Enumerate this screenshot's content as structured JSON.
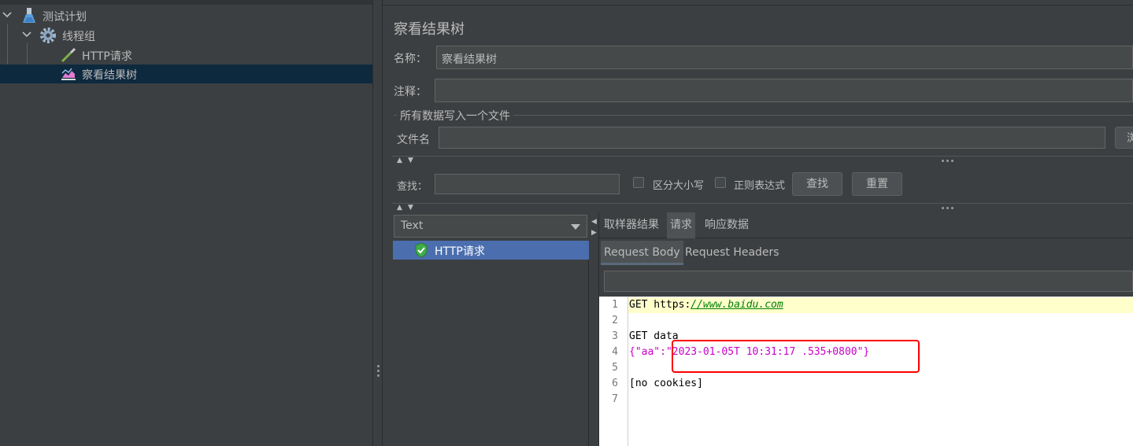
{
  "tree": {
    "items": [
      {
        "label": "测试计划",
        "icon": "flask-icon",
        "expanded": true
      },
      {
        "label": "线程组",
        "icon": "gear-icon",
        "expanded": true
      },
      {
        "label": "HTTP请求",
        "icon": "pipette-icon"
      },
      {
        "label": "察看结果树",
        "icon": "chart-icon",
        "selected": true
      }
    ]
  },
  "panel": {
    "title": "察看结果树",
    "name_label": "名称：",
    "name_value": "察看结果树",
    "comment_label": "注释：",
    "comment_value": "",
    "file_section_title": "所有数据写入一个文件",
    "file_label": "文件名",
    "file_value": "",
    "browse_button": "浏",
    "search_label": "查找：",
    "search_value": "",
    "case_sensitive_label": "区分大小写",
    "regex_label": "正则表达式",
    "find_button": "查找",
    "reset_button": "重置"
  },
  "results": {
    "renderer_selected": "Text",
    "samples": [
      {
        "label": "HTTP请求",
        "status": "success"
      }
    ]
  },
  "detail": {
    "tabs": [
      "取样器结果",
      "请求",
      "响应数据"
    ],
    "active_tab": "请求",
    "subtabs": [
      "Request Body",
      "Request Headers"
    ],
    "active_subtab": "Request Body",
    "lines": [
      {
        "n": "1",
        "text": "GET https://www.baidu.com"
      },
      {
        "n": "2",
        "text": ""
      },
      {
        "n": "3",
        "text": "GET data:"
      },
      {
        "n": "4",
        "text": "{\"aa\":\"2023-01-05T 10:31:17 .535+0800\"}"
      },
      {
        "n": "5",
        "text": ""
      },
      {
        "n": "6",
        "text": "[no cookies]"
      },
      {
        "n": "7",
        "text": ""
      }
    ],
    "line1_prefix": "GET https:",
    "line1_link": "//www.baidu.com",
    "line3": "GET data",
    "line4_key": "{\"aa\":",
    "line4_value": "\"2023-01-05T 10:31:17 .535+0800\"",
    "line4_close": "}",
    "line6": "[no cookies]"
  },
  "colors": {
    "background": "#3c3f41",
    "selection": "#4b6eaf",
    "highlight_box": "#ff0000",
    "link": "#008000",
    "string": "#c800c8"
  }
}
